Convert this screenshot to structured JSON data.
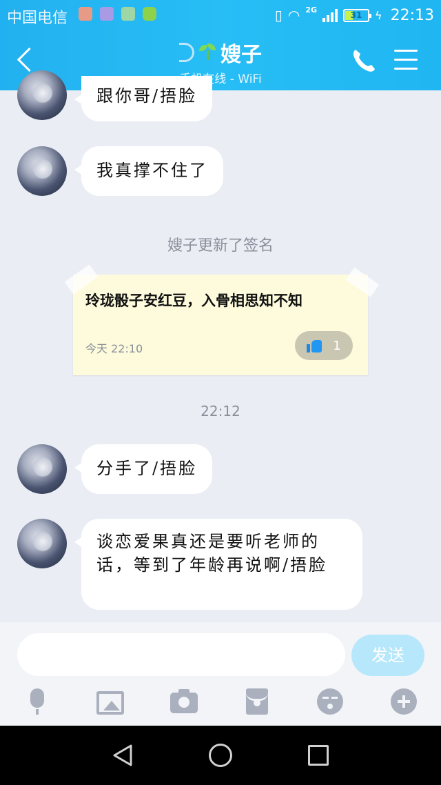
{
  "status_bar": {
    "carrier": "中国电信",
    "network": "2G",
    "battery": "31",
    "time": "22:13"
  },
  "nav": {
    "title": "嫂子",
    "subtitle": "手机在线 - WiFi"
  },
  "messages": [
    {
      "text": "跟你哥/捂脸"
    },
    {
      "text": "我真撑不住了"
    }
  ],
  "signature_notice": "嫂子更新了签名",
  "signature_card": {
    "text": "玲珑骰子安红豆，入骨相思知不知",
    "time": "今天 22:10",
    "likes": "1"
  },
  "time_divider": "22:12",
  "messages_after": [
    {
      "text": "分手了/捂脸"
    },
    {
      "text": "谈恋爱果真还是要听老师的话，等到了年龄再说啊/捂脸"
    }
  ],
  "input": {
    "value": "",
    "send_label": "发送"
  },
  "colors": {
    "header": "#22b1f0",
    "send_disabled": "#b7e7fb",
    "card_bg": "#fdfbdc"
  }
}
